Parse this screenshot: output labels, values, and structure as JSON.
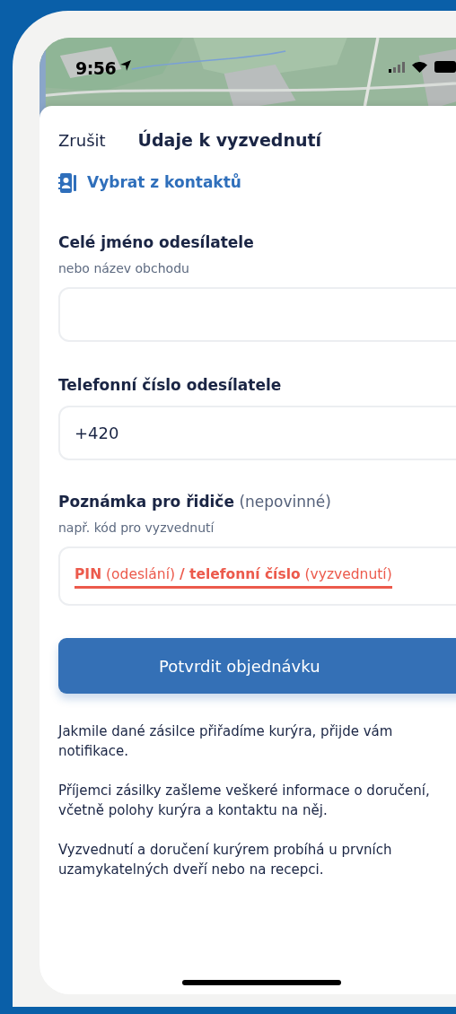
{
  "status_bar": {
    "time": "9:56"
  },
  "header": {
    "cancel": "Zrušit",
    "title": "Údaje k vyzvednutí"
  },
  "contacts_link": {
    "label": "Vybrat z kontaktů"
  },
  "fields": [
    {
      "kind": "plain",
      "label": "Celé jméno odesílatele",
      "hint": "nebo název obchodu"
    },
    {
      "kind": "plain",
      "label": "Telefonní číslo odesílatele",
      "value": "+420"
    },
    {
      "kind": "annotated",
      "label": "**Poznámka pro řidiče** (nepovinné)",
      "hint": "např. kód pro vyzvednutí",
      "value": "**PIN** (odeslání) **/ telefonní číslo** (vyzvednutí)"
    }
  ],
  "submit": {
    "label": "Potvrdit objednávku"
  },
  "notes": [
    "Jakmile dané zásilce přiřadíme kurýra, přijde vám notifikace.",
    "Příjemci zásilky zašleme veškeré informace o doručení, včetně polohy kurýra a kontaktu na něj.",
    "Vyzvednutí a doručení kurýrem probíhá u prvních uzamykatelných dveří nebo na recepci."
  ]
}
